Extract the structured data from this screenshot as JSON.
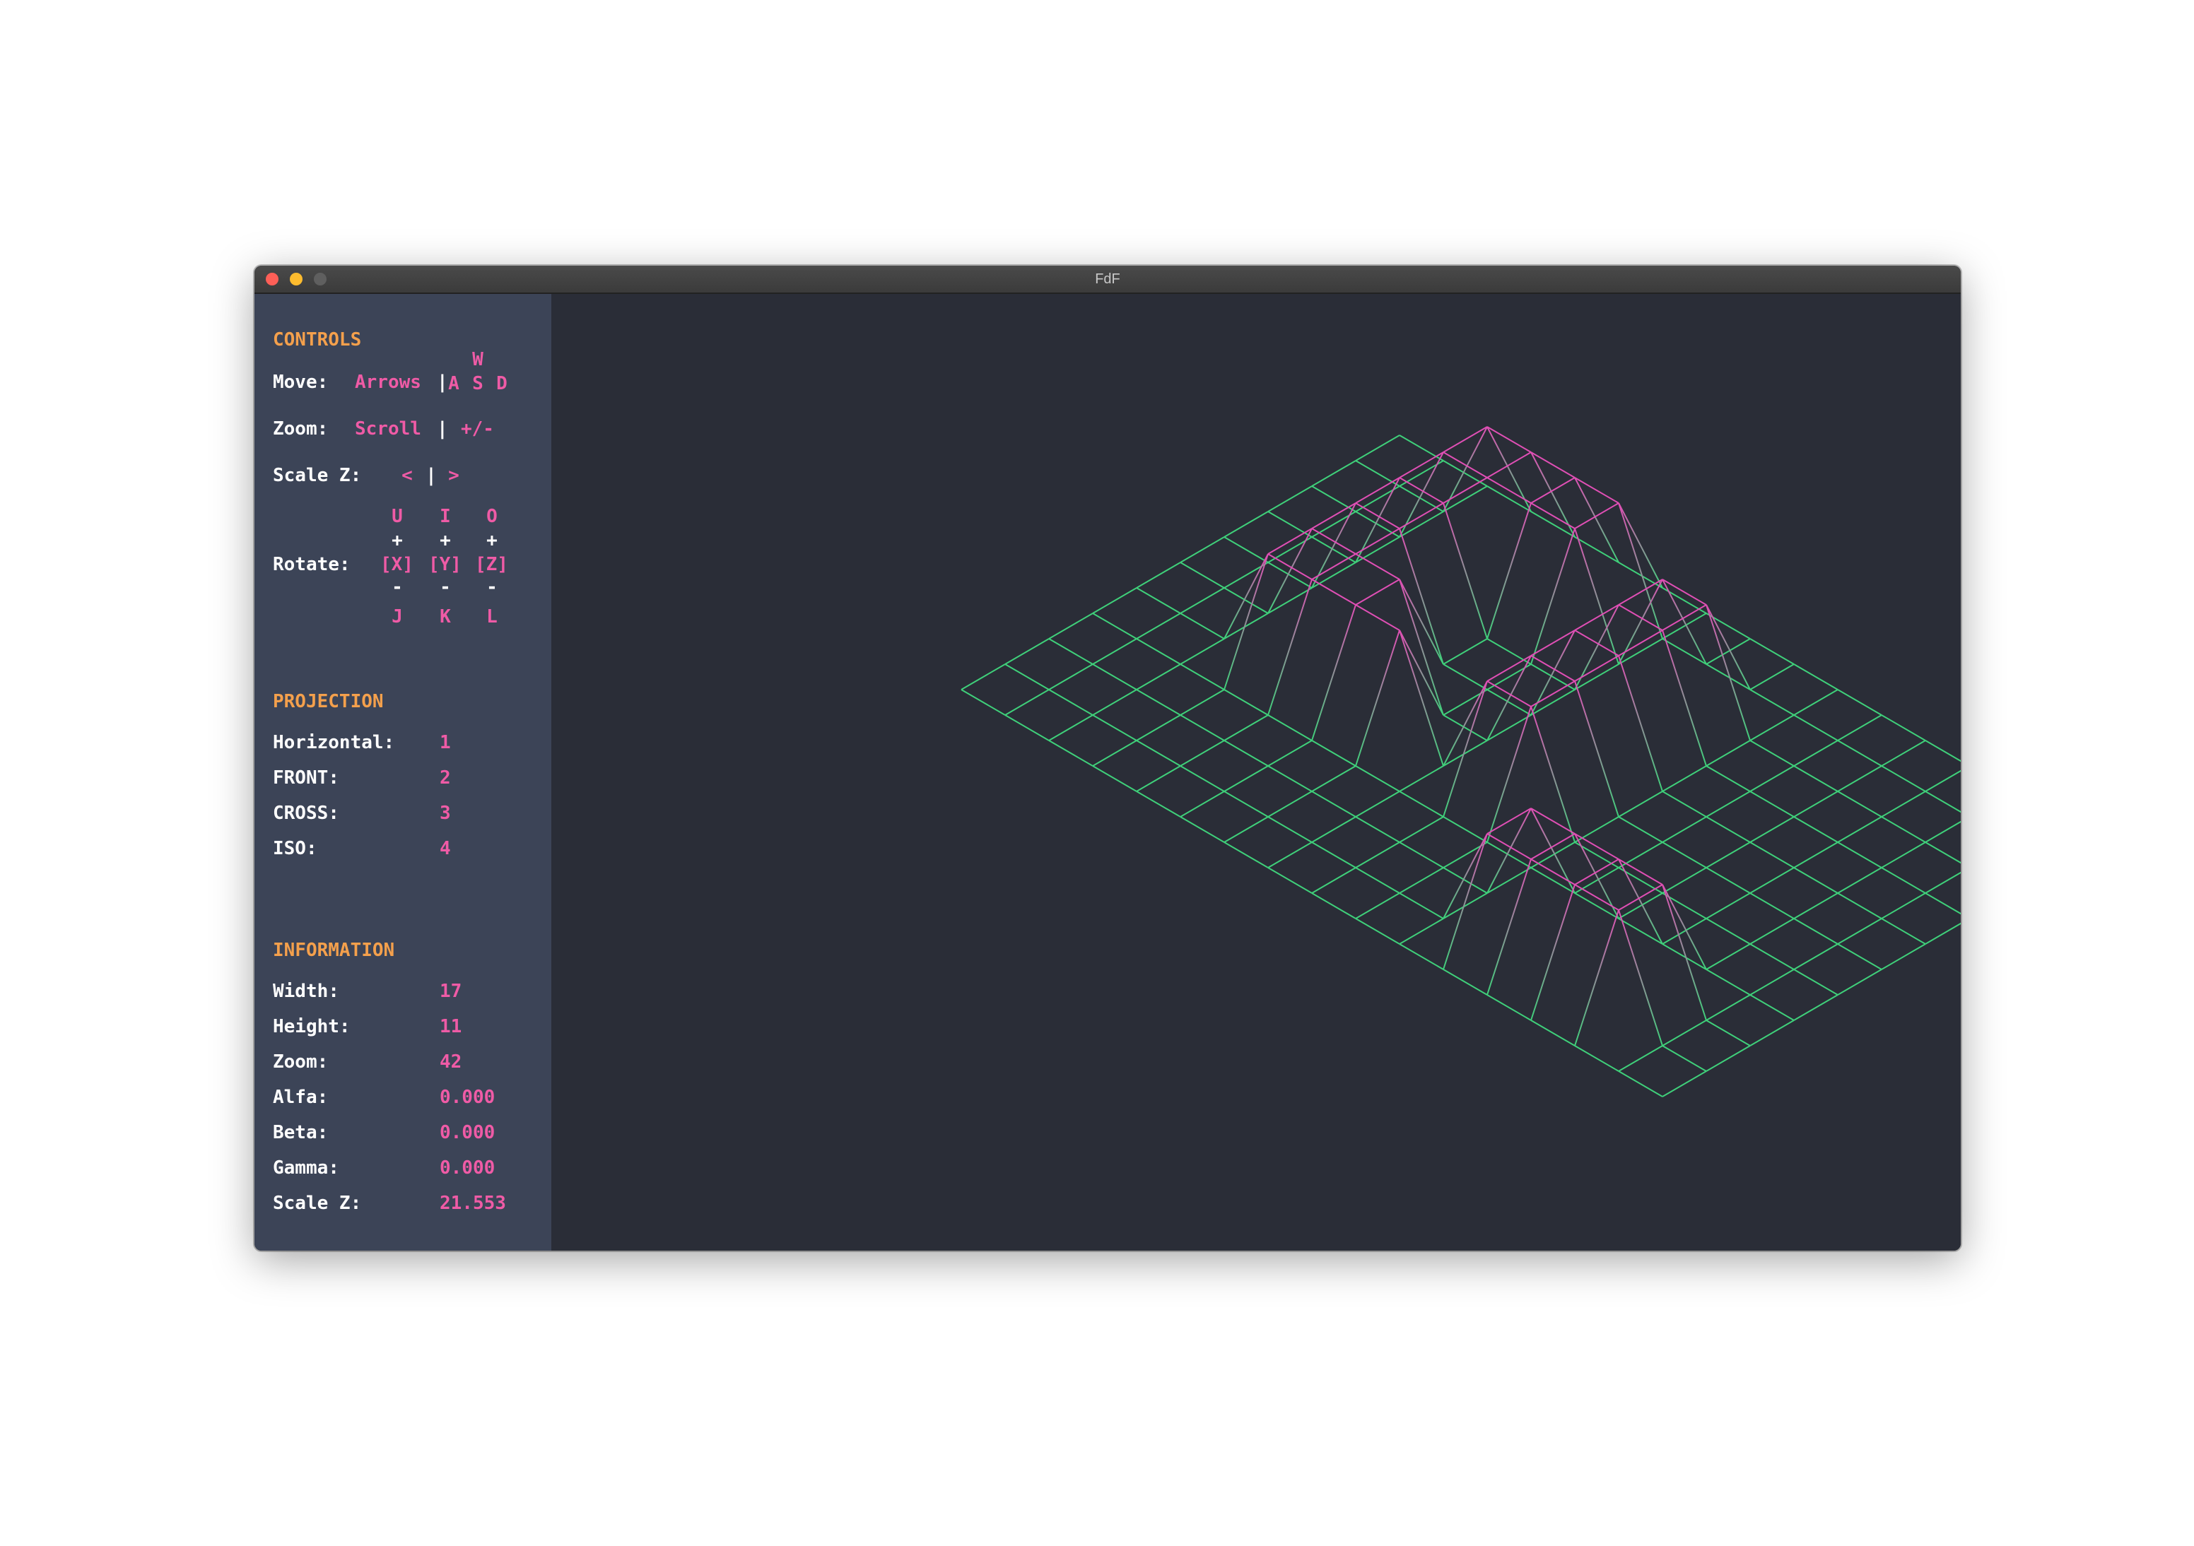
{
  "window": {
    "title": "FdF"
  },
  "colors": {
    "sidebar_bg": "#3c4457",
    "canvas_bg": "#2a2d37",
    "header": "#f4a04c",
    "accent": "#ef5ba6",
    "label": "#ffffff",
    "wire_low": "#3fd07a",
    "wire_high": "#e04fb5"
  },
  "controls": {
    "header": "CONTROLS",
    "move_label": "Move:",
    "move_value": "Arrows",
    "move_sep": "|",
    "key_w": "W",
    "key_a": "A",
    "key_s": "S",
    "key_d": "D",
    "zoom_label": "Zoom:",
    "zoom_value": "Scroll",
    "zoom_sep": "|",
    "zoom_keys": "+/-",
    "scalez_label": "Scale Z:",
    "scalez_left": "<",
    "scalez_sep": "|",
    "scalez_right": ">",
    "rotate_label": "Rotate:",
    "rot_x": {
      "up": "U",
      "plus": "+",
      "axis": "[X]",
      "minus": "-",
      "down": "J"
    },
    "rot_y": {
      "up": "I",
      "plus": "+",
      "axis": "[Y]",
      "minus": "-",
      "down": "K"
    },
    "rot_z": {
      "up": "O",
      "plus": "+",
      "axis": "[Z]",
      "minus": "-",
      "down": "L"
    }
  },
  "projection": {
    "header": "PROJECTION",
    "items": [
      {
        "label": "Horizontal:",
        "key": "1"
      },
      {
        "label": "FRONT:",
        "key": "2"
      },
      {
        "label": "CROSS:",
        "key": "3"
      },
      {
        "label": "ISO:",
        "key": "4"
      }
    ]
  },
  "information": {
    "header": "INFORMATION",
    "items": [
      {
        "label": "Width:",
        "value": "17"
      },
      {
        "label": "Height:",
        "value": "11"
      },
      {
        "label": "Zoom:",
        "value": "42"
      },
      {
        "label": "Alfa:",
        "value": "0.000"
      },
      {
        "label": "Beta:",
        "value": "0.000"
      },
      {
        "label": "Gamma:",
        "value": "0.000"
      },
      {
        "label": "Scale Z:",
        "value": "21.553"
      }
    ]
  },
  "map": {
    "projection": "ISO",
    "columns": 17,
    "rows": 11,
    "heights": [
      [
        0,
        0,
        0,
        0,
        0,
        0,
        0,
        0,
        0,
        0,
        0,
        0,
        0,
        0,
        0,
        0,
        0
      ],
      [
        0,
        0,
        0,
        10,
        10,
        10,
        10,
        0,
        0,
        0,
        0,
        0,
        0,
        0,
        0,
        0,
        0
      ],
      [
        0,
        0,
        0,
        10,
        10,
        10,
        10,
        0,
        10,
        10,
        0,
        0,
        0,
        0,
        0,
        0,
        0
      ],
      [
        0,
        0,
        0,
        10,
        10,
        0,
        0,
        0,
        10,
        10,
        0,
        0,
        0,
        0,
        0,
        0,
        0
      ],
      [
        0,
        0,
        0,
        10,
        10,
        0,
        0,
        0,
        10,
        10,
        0,
        0,
        0,
        0,
        0,
        0,
        0
      ],
      [
        0,
        0,
        0,
        10,
        10,
        10,
        0,
        0,
        10,
        10,
        0,
        0,
        0,
        0,
        0,
        0,
        0
      ],
      [
        0,
        0,
        0,
        10,
        10,
        10,
        10,
        0,
        10,
        10,
        0,
        0,
        0,
        0,
        0,
        0,
        0
      ],
      [
        0,
        0,
        0,
        0,
        0,
        0,
        0,
        0,
        0,
        0,
        0,
        0,
        0,
        0,
        0,
        0,
        0
      ],
      [
        0,
        0,
        0,
        0,
        0,
        0,
        0,
        0,
        0,
        0,
        0,
        10,
        10,
        10,
        10,
        0,
        0
      ],
      [
        0,
        0,
        0,
        0,
        0,
        0,
        0,
        0,
        0,
        0,
        0,
        10,
        10,
        10,
        10,
        0,
        0
      ],
      [
        0,
        0,
        0,
        0,
        0,
        0,
        0,
        0,
        0,
        0,
        0,
        0,
        0,
        0,
        0,
        0,
        0
      ]
    ]
  }
}
